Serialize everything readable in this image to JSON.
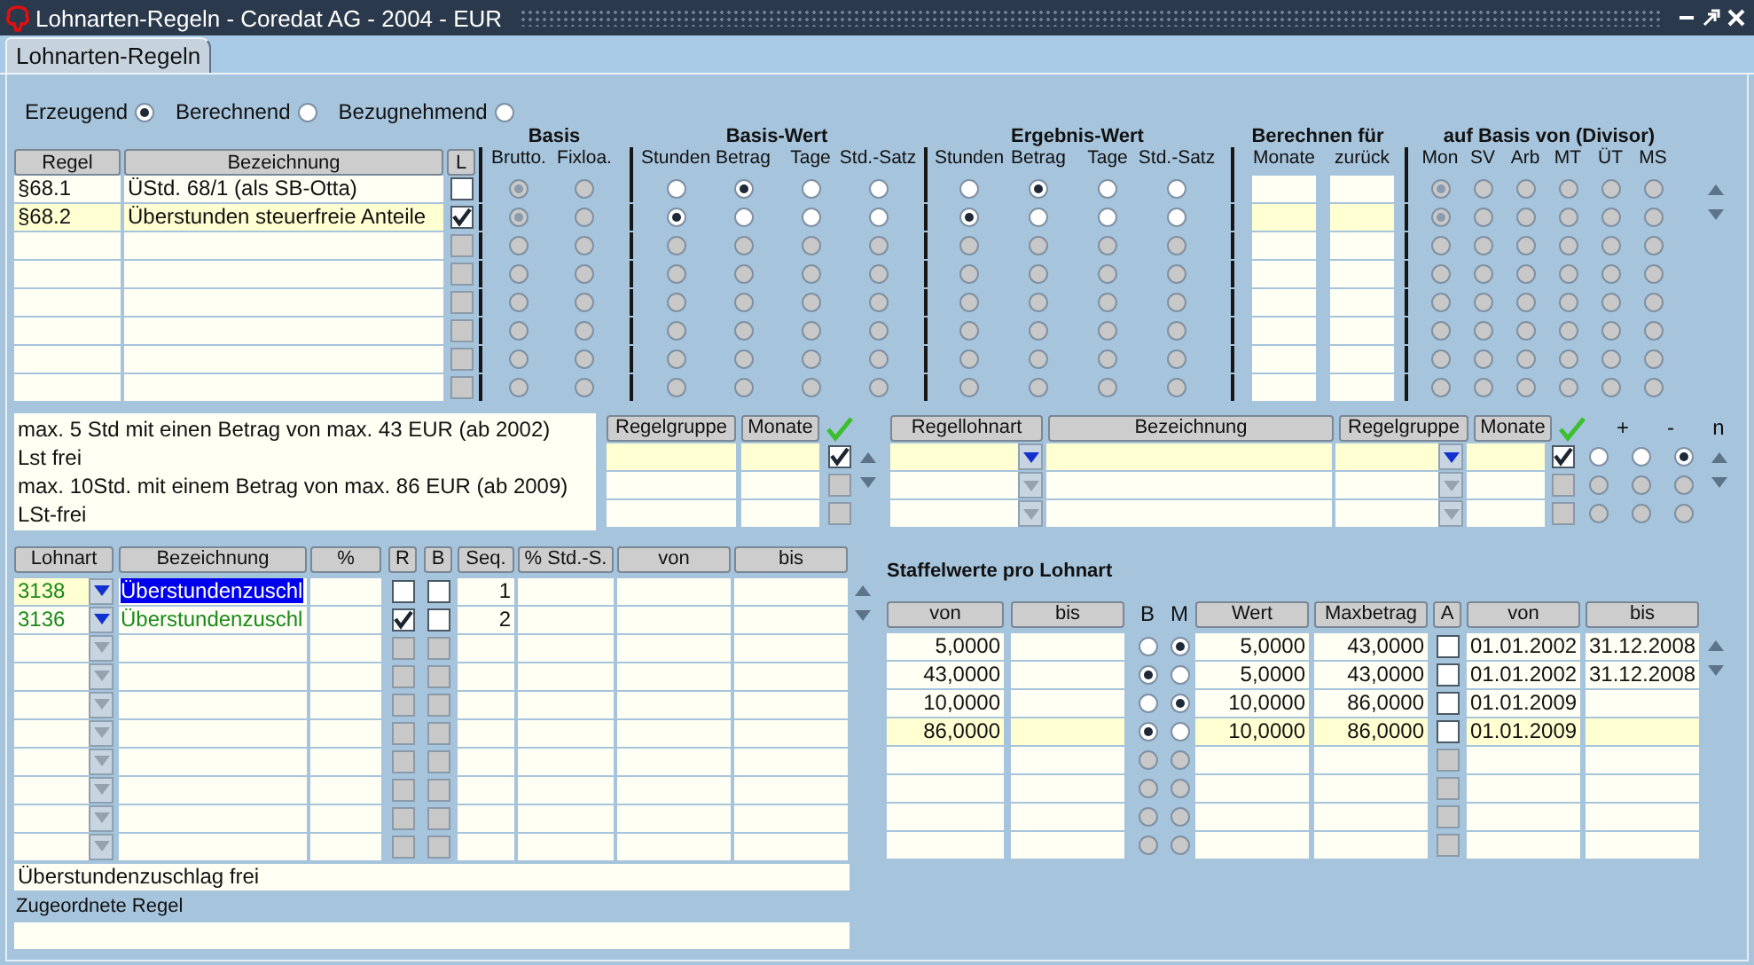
{
  "window": {
    "title": "Lohnarten-Regeln - Coredat AG - 2004 - EUR"
  },
  "tabs": [
    {
      "label": "Lohnarten-Regeln",
      "selected": true
    }
  ],
  "modes": [
    {
      "label": "Erzeugend",
      "selected": true
    },
    {
      "label": "Berechnend",
      "selected": false
    },
    {
      "label": "Bezugnehmend",
      "selected": false
    }
  ],
  "rules": {
    "columns": [
      "Regel",
      "Bezeichnung",
      "L"
    ],
    "sections": [
      {
        "kind": "radio",
        "title": "Basis",
        "options": [
          "Brutto.",
          "Fixloa."
        ]
      },
      {
        "kind": "radio",
        "title": "Basis-Wert",
        "options": [
          "Stunden",
          "Betrag",
          "Tage",
          "Std.-Satz"
        ]
      },
      {
        "kind": "radio",
        "title": "Ergebnis-Wert",
        "options": [
          "Stunden",
          "Betrag",
          "Tage",
          "Std.-Satz"
        ]
      },
      {
        "kind": "input",
        "title": "Berechnen für",
        "options": [
          "Monate",
          "zurück"
        ]
      },
      {
        "kind": "radio",
        "title": "auf Basis von (Divisor)",
        "options": [
          "Mon",
          "SV",
          "Arb",
          "MT",
          "ÜT",
          "MS"
        ]
      }
    ],
    "rows": [
      {
        "enabled": true,
        "selected": false,
        "regel": "§68.1",
        "bezeichnung": "ÜStd. 68/1 (als SB-Otta)",
        "l_checked": false,
        "groups": [
          {
            "disabled": true,
            "selected": [
              true,
              false
            ]
          },
          {
            "disabled": false,
            "selected": [
              false,
              true,
              false,
              false
            ]
          },
          {
            "disabled": false,
            "selected": [
              false,
              true,
              false,
              false
            ]
          },
          {
            "disabled": true,
            "selected": [
              true,
              false,
              false,
              false,
              false,
              false
            ]
          }
        ]
      },
      {
        "enabled": true,
        "selected": true,
        "regel": "§68.2",
        "bezeichnung": "Überstunden steuerfreie Anteile",
        "l_checked": true,
        "groups": [
          {
            "disabled": true,
            "selected": [
              true,
              false
            ]
          },
          {
            "disabled": false,
            "selected": [
              true,
              false,
              false,
              false
            ]
          },
          {
            "disabled": false,
            "selected": [
              true,
              false,
              false,
              false
            ]
          },
          {
            "disabled": true,
            "selected": [
              true,
              false,
              false,
              false,
              false,
              false
            ]
          }
        ]
      },
      {
        "enabled": false,
        "selected": false
      },
      {
        "enabled": false,
        "selected": false
      },
      {
        "enabled": false,
        "selected": false
      },
      {
        "enabled": false,
        "selected": false
      },
      {
        "enabled": false,
        "selected": false
      },
      {
        "enabled": false,
        "selected": false
      }
    ]
  },
  "notes": [
    "max. 5 Std mit einen Betrag von max. 43 EUR (ab 2002)",
    "Lst frei",
    "max. 10Std. mit einem Betrag von max. 86 EUR (ab 2009)",
    "LSt-frei"
  ],
  "rule_groups": {
    "columns": [
      "Regelgruppe",
      "Monate"
    ],
    "rows": [
      {
        "enabled": true,
        "selected": true,
        "checked": true
      },
      {
        "enabled": false,
        "selected": false,
        "checked": false
      },
      {
        "enabled": false,
        "selected": false,
        "checked": false
      }
    ]
  },
  "rule_wage_types": {
    "columns": [
      "Regellohnart",
      "Bezeichnung",
      "Regelgruppe",
      "Monate"
    ],
    "signs": [
      "+",
      "-",
      "n"
    ],
    "rows": [
      {
        "enabled": true,
        "selected": true,
        "checked": true,
        "sign": [
          false,
          false,
          true
        ]
      },
      {
        "enabled": false,
        "selected": false,
        "checked": false,
        "sign": [
          false,
          false,
          false
        ]
      },
      {
        "enabled": false,
        "selected": false,
        "checked": false,
        "sign": [
          false,
          false,
          false
        ]
      }
    ]
  },
  "wage_types": {
    "columns": [
      "Lohnart",
      "Bezeichnung",
      "%",
      "R",
      "B",
      "Seq.",
      "% Std.-S.",
      "von",
      "bis"
    ],
    "rows": [
      {
        "enabled": true,
        "selected": true,
        "lohnart": "3138",
        "bezeichnung": "Überstundenzuschl",
        "focused": true,
        "r": false,
        "b": false,
        "seq": "1"
      },
      {
        "enabled": true,
        "selected": false,
        "lohnart": "3136",
        "bezeichnung": "Überstundenzuschl",
        "focused": false,
        "r": true,
        "b": false,
        "seq": "2"
      },
      {
        "enabled": false,
        "selected": false
      },
      {
        "enabled": false,
        "selected": false
      },
      {
        "enabled": false,
        "selected": false
      },
      {
        "enabled": false,
        "selected": false
      },
      {
        "enabled": false,
        "selected": false
      },
      {
        "enabled": false,
        "selected": false
      },
      {
        "enabled": false,
        "selected": false
      },
      {
        "enabled": false,
        "selected": false
      }
    ]
  },
  "description_field": {
    "value": "Überstundenzuschlag frei"
  },
  "assigned_rule": {
    "label": "Zugeordnete Regel"
  },
  "scales": {
    "title": "Staffelwerte pro Lohnart",
    "columns": [
      "von",
      "bis",
      "B",
      "M",
      "Wert",
      "Maxbetrag",
      "A",
      "von",
      "bis"
    ],
    "rows": [
      {
        "enabled": true,
        "selected": false,
        "von": "5,0000",
        "b": false,
        "m": true,
        "wert": "5,0000",
        "maxbetrag": "43,0000",
        "a": false,
        "gueltig_von": "01.01.2002",
        "gueltig_bis": "31.12.2008"
      },
      {
        "enabled": true,
        "selected": false,
        "von": "43,0000",
        "b": true,
        "m": false,
        "wert": "5,0000",
        "maxbetrag": "43,0000",
        "a": false,
        "gueltig_von": "01.01.2002",
        "gueltig_bis": "31.12.2008"
      },
      {
        "enabled": true,
        "selected": false,
        "von": "10,0000",
        "b": false,
        "m": true,
        "wert": "10,0000",
        "maxbetrag": "86,0000",
        "a": false,
        "gueltig_von": "01.01.2009"
      },
      {
        "enabled": true,
        "selected": true,
        "von": "86,0000",
        "b": true,
        "m": false,
        "wert": "10,0000",
        "maxbetrag": "86,0000",
        "a": false,
        "gueltig_von": "01.01.2009"
      },
      {
        "enabled": false,
        "selected": false
      },
      {
        "enabled": false,
        "selected": false
      },
      {
        "enabled": false,
        "selected": false
      },
      {
        "enabled": false,
        "selected": false
      }
    ]
  }
}
